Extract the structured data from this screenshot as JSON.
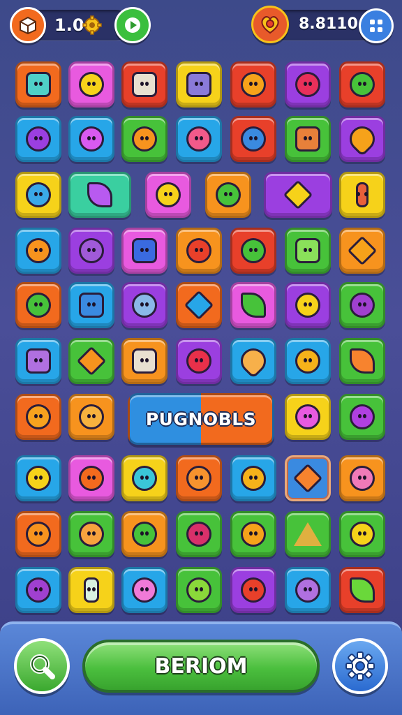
{
  "topbar": {
    "level_value": "1.0",
    "score_value": "8.8110",
    "left_icon": "box-icon",
    "coin_icon": "gear-coin-icon",
    "play_icon": "play-icon",
    "heart_icon": "heart-icon",
    "menu_icon": "grid-menu-icon"
  },
  "banner": {
    "label": "PUGNOBLS"
  },
  "bottombar": {
    "main_label": "BERIOM",
    "search_icon": "search-icon",
    "settings_icon": "gear-icon"
  },
  "colors": {
    "red": "#e8402a",
    "pink": "#e85adf",
    "yellow": "#f6d21a",
    "orange": "#f7931e",
    "purple": "#9b3fe0",
    "green": "#47c23a",
    "blue": "#27a6e8",
    "teal": "#26c6d6"
  }
}
